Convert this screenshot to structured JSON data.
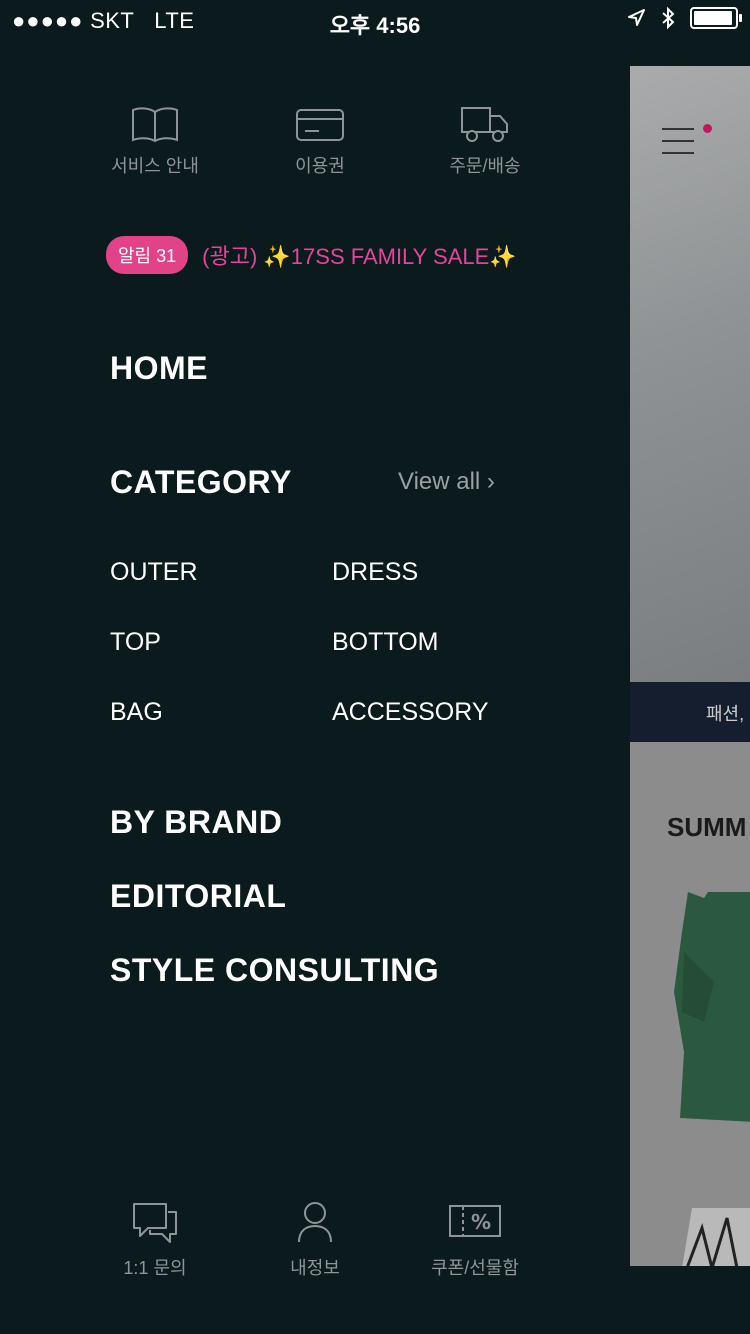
{
  "status_bar": {
    "signal": "●●●●●",
    "carrier": "SKT",
    "network": "LTE",
    "time": "오후 4:56"
  },
  "quick_links": [
    {
      "label": "서비스 안내",
      "icon": "book-icon"
    },
    {
      "label": "이용권",
      "icon": "card-icon"
    },
    {
      "label": "주문/배송",
      "icon": "truck-icon"
    }
  ],
  "notice": {
    "badge": "알림 31",
    "text": "(광고) ✨17SS FAMILY SALE✨"
  },
  "menu": {
    "home": "HOME",
    "category": "CATEGORY",
    "view_all": "View all ›",
    "categories": [
      "OUTER",
      "DRESS",
      "TOP",
      "BOTTOM",
      "BAG",
      "ACCESSORY"
    ],
    "by_brand": "BY BRAND",
    "editorial": "EDITORIAL",
    "style_consulting": "STYLE CONSULTING"
  },
  "bottom_links": [
    {
      "label": "1:1 문의",
      "icon": "chat-icon"
    },
    {
      "label": "내정보",
      "icon": "user-icon"
    },
    {
      "label": "쿠폰/선물함",
      "icon": "coupon-icon"
    }
  ],
  "preview": {
    "band_text": "패션,",
    "section_title": "SUMM",
    "accent_color": "#c2185b"
  },
  "colors": {
    "background": "#0b1a1c",
    "badge": "#e24388",
    "notice_text": "#e2459a",
    "muted_label": "#8e9597"
  }
}
